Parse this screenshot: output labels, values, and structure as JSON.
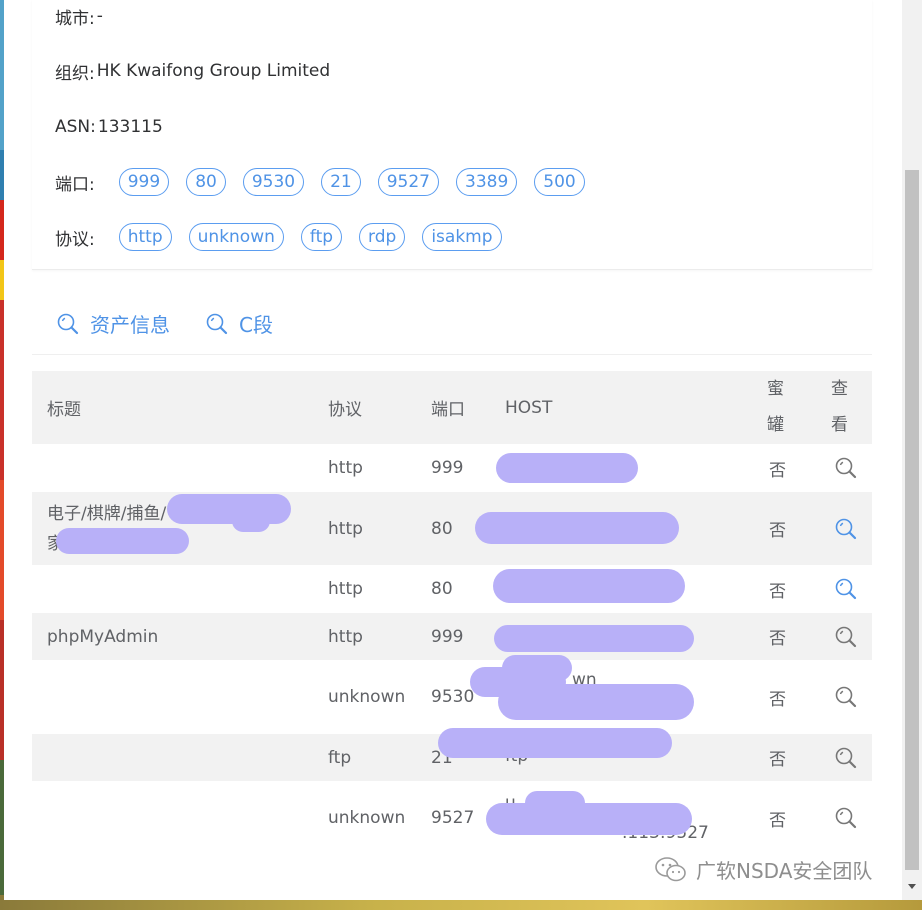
{
  "info": {
    "city_label": "城市:",
    "city_value": "-",
    "org_label": "组织:",
    "org_value": "HK Kwaifong Group Limited",
    "asn_label": "ASN:",
    "asn_value": "133115",
    "ports_label": "端口:",
    "ports": [
      "999",
      "80",
      "9530",
      "21",
      "9527",
      "3389",
      "500"
    ],
    "protocols_label": "协议:",
    "protocols": [
      "http",
      "unknown",
      "ftp",
      "rdp",
      "isakmp"
    ]
  },
  "tabs": [
    {
      "label": "资产信息"
    },
    {
      "label": "C段"
    }
  ],
  "table": {
    "headers": {
      "title": "标题",
      "protocol": "协议",
      "port": "端口",
      "host": "HOST",
      "honeypot_1": "蜜",
      "honeypot_2": "罐",
      "view_1": "查",
      "view_2": "看"
    },
    "rows": [
      {
        "title_1": "",
        "title_2": "",
        "protocol": "http",
        "port": "999",
        "host_1": "",
        "host_2": "",
        "honeypot": "否"
      },
      {
        "title_1": "电子/棋牌/捕鱼/",
        "title_2": "家",
        "protocol": "http",
        "port": "80",
        "host_1": "",
        "host_2": "",
        "honeypot": "否"
      },
      {
        "title_1": "",
        "title_2": "",
        "protocol": "http",
        "port": "80",
        "host_1": "",
        "host_2": "",
        "honeypot": "否"
      },
      {
        "title_1": "phpMyAdmin",
        "title_2": "",
        "protocol": "http",
        "port": "999",
        "host_1": "",
        "host_2": "",
        "honeypot": "否"
      },
      {
        "title_1": "",
        "title_2": "",
        "protocol": "unknown",
        "port": "9530",
        "host_1": "wn",
        "host_2": "",
        "honeypot": "否"
      },
      {
        "title_1": "",
        "title_2": "",
        "protocol": "ftp",
        "port": "21",
        "host_1": "ftp",
        "host_2": "",
        "honeypot": "否"
      },
      {
        "title_1": "",
        "title_2": "",
        "protocol": "unknown",
        "port": "9527",
        "host_1": "u",
        "host_2": ".113:9527",
        "honeypot": "否"
      }
    ]
  },
  "watermark": "广软NSDA安全团队",
  "colors": {
    "accent": "#4f93e6",
    "redaction": "#b8b0f8",
    "header_bg": "#f2f2f2"
  }
}
